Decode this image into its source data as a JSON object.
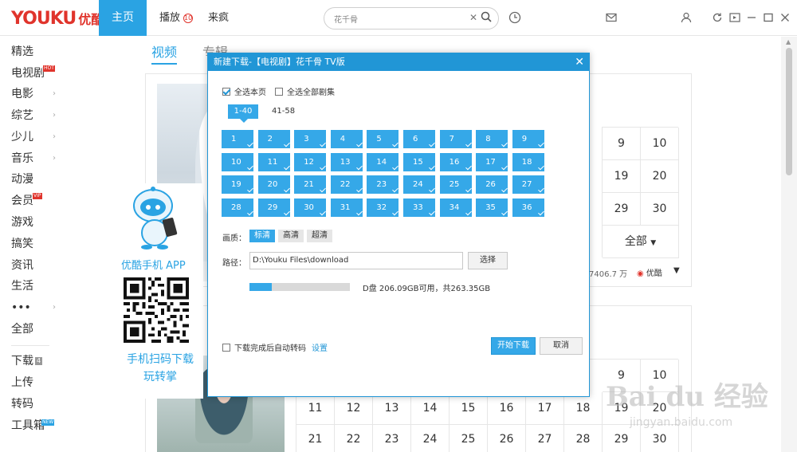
{
  "app": {
    "logo_latin": "YOUKU",
    "logo_cn": "优酷",
    "nav": {
      "home": "主页",
      "play": "播放",
      "play_badge": "10",
      "laifeng": "来疯"
    },
    "search": {
      "value": "花千骨"
    }
  },
  "sidebar": {
    "items": [
      {
        "label": "精选",
        "arrow": false,
        "tag": ""
      },
      {
        "label": "电视剧",
        "arrow": false,
        "tag": "HOT"
      },
      {
        "label": "电影",
        "arrow": true,
        "tag": ""
      },
      {
        "label": "综艺",
        "arrow": true,
        "tag": ""
      },
      {
        "label": "少儿",
        "arrow": true,
        "tag": ""
      },
      {
        "label": "音乐",
        "arrow": true,
        "tag": ""
      },
      {
        "label": "动漫",
        "arrow": false,
        "tag": ""
      },
      {
        "label": "会员",
        "arrow": false,
        "tag": "VIP"
      },
      {
        "label": "游戏",
        "arrow": false,
        "tag": ""
      },
      {
        "label": "搞笑",
        "arrow": false,
        "tag": ""
      },
      {
        "label": "资讯",
        "arrow": false,
        "tag": ""
      },
      {
        "label": "生活",
        "arrow": false,
        "tag": ""
      },
      {
        "label": "•••",
        "arrow": true,
        "tag": ""
      },
      {
        "label": "全部",
        "arrow": false,
        "tag": ""
      }
    ],
    "tools": [
      {
        "label": "下载",
        "tag": "4"
      },
      {
        "label": "上传",
        "tag": ""
      },
      {
        "label": "转码",
        "tag": ""
      },
      {
        "label": "工具箱",
        "tag": "NEW"
      }
    ]
  },
  "main": {
    "tabs": [
      "视频",
      "专辑"
    ],
    "card1": {
      "episodes": [
        [
          "9",
          "10"
        ],
        [
          "19",
          "20"
        ],
        [
          "29",
          "30"
        ]
      ],
      "all_label": "全部",
      "views": "7406.7 万",
      "source": "优酷"
    },
    "card2": {
      "row_top": [
        "9",
        "10"
      ],
      "row_mid": [
        "11",
        "12",
        "13",
        "14",
        "15",
        "16",
        "17",
        "18",
        "19",
        "20"
      ],
      "row_bot": [
        "21",
        "22",
        "23",
        "24",
        "25",
        "26",
        "27",
        "28",
        "29",
        "30"
      ]
    }
  },
  "promo": {
    "title": "优酷手机 APP",
    "text": "手机扫码下载 玩转掌"
  },
  "dialog": {
    "title": "新建下载-【电视剧】花千骨 TV版",
    "select_page": "全选本页",
    "select_all": "全选全部剧集",
    "page_tabs": [
      "1-40",
      "41-58"
    ],
    "episodes": [
      "1",
      "2",
      "3",
      "4",
      "5",
      "6",
      "7",
      "8",
      "9",
      "10",
      "11",
      "12",
      "13",
      "14",
      "15",
      "16",
      "17",
      "18",
      "19",
      "20",
      "21",
      "22",
      "23",
      "24",
      "25",
      "26",
      "27",
      "28",
      "29",
      "30",
      "31",
      "32",
      "33",
      "34",
      "35",
      "36"
    ],
    "quality_label": "画质：",
    "quality_options": [
      "标清",
      "高清",
      "超清"
    ],
    "path_label": "路径：",
    "path_value": "D:\\Youku Files\\download",
    "choose_button": "选择",
    "disk_usage_fraction": 0.22,
    "disk_text": "D盘 206.09GB可用，共263.35GB",
    "auto_transcode": "下载完成后自动转码",
    "settings_link": "设置",
    "start_button": "开始下载",
    "cancel_button": "取消"
  },
  "watermark": {
    "big": "Bai du 经验",
    "small": "jingyan.baidu.com"
  }
}
